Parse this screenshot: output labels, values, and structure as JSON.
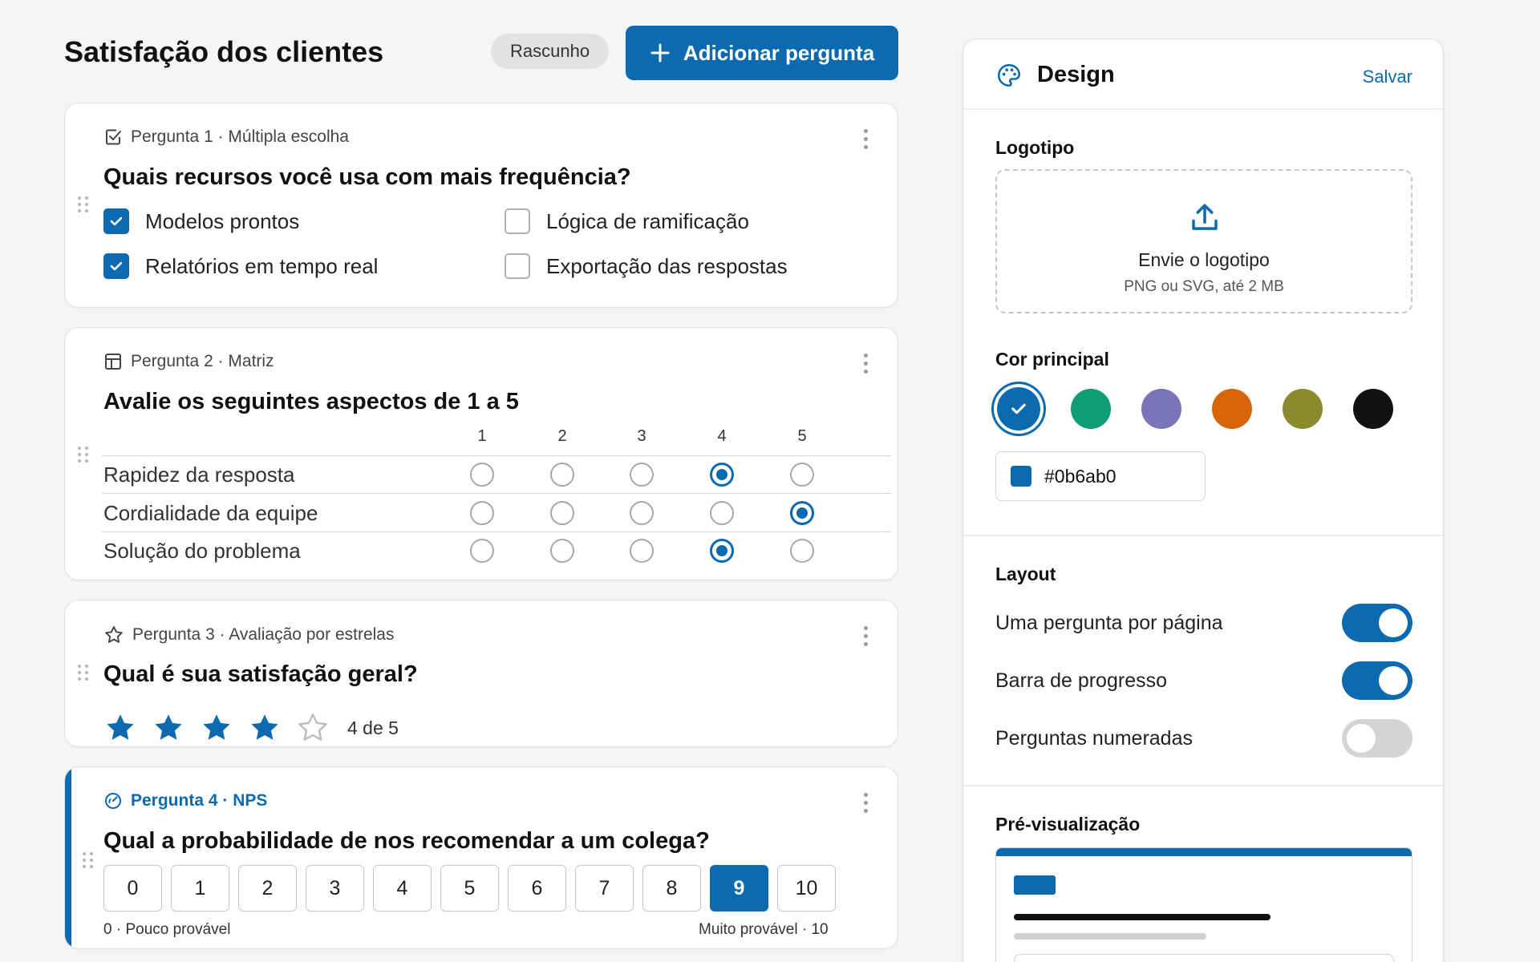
{
  "header": {
    "title": "Satisfação dos clientes",
    "status_badge": "Rascunho",
    "add_question_label": "Adicionar pergunta"
  },
  "q1": {
    "meta": "Pergunta 1 · Múltipla escolha",
    "icon": "checkbox-square-icon",
    "title": "Quais recursos você usa com mais frequência?",
    "options": [
      {
        "label": "Modelos prontos",
        "checked": true
      },
      {
        "label": "Lógica de ramificação",
        "checked": false
      },
      {
        "label": "Relatórios em tempo real",
        "checked": true
      },
      {
        "label": "Exportação das respostas",
        "checked": false
      }
    ]
  },
  "q2": {
    "meta": "Pergunta 2 · Matriz",
    "icon": "table-grid-icon",
    "title": "Avalie os seguintes aspectos de 1 a 5",
    "columns": [
      "1",
      "2",
      "3",
      "4",
      "5"
    ],
    "rows": [
      {
        "label": "Rapidez da resposta",
        "selected": 4
      },
      {
        "label": "Cordialidade da equipe",
        "selected": 5
      },
      {
        "label": "Solução do problema",
        "selected": 4
      }
    ]
  },
  "q3": {
    "meta": "Pergunta 3 · Avaliação por estrelas",
    "icon": "star-outline-icon",
    "title": "Qual é sua satisfação geral?",
    "rating": 4,
    "max": 5,
    "rating_text": "4 de 5"
  },
  "q4": {
    "meta": "Pergunta 4 · NPS",
    "icon": "gauge-icon",
    "title": "Qual a probabilidade de nos recomendar a um colega?",
    "scale": [
      "0",
      "1",
      "2",
      "3",
      "4",
      "5",
      "6",
      "7",
      "8",
      "9",
      "10"
    ],
    "selected": "9",
    "low_label": "0 · Pouco provável",
    "high_label": "Muito provável · 10"
  },
  "design": {
    "title": "Design",
    "icon": "palette-icon",
    "save_label": "Salvar",
    "logo": {
      "section_title": "Logotipo",
      "upload_title": "Envie o logotipo",
      "upload_hint": "PNG ou SVG, até 2 MB",
      "icon": "upload-icon"
    },
    "color": {
      "section_title": "Cor principal",
      "swatches": [
        "#0b6ab0",
        "#0f9d73",
        "#7b74b8",
        "#d9650a",
        "#8b8b2e",
        "#111111"
      ],
      "selected": "#0b6ab0",
      "hex_value": "#0b6ab0"
    },
    "layout": {
      "section_title": "Layout",
      "toggles": [
        {
          "label": "Uma pergunta por página",
          "on": true
        },
        {
          "label": "Barra de progresso",
          "on": true
        },
        {
          "label": "Perguntas numeradas",
          "on": false
        }
      ]
    },
    "preview": {
      "section_title": "Pré-visualização"
    }
  }
}
